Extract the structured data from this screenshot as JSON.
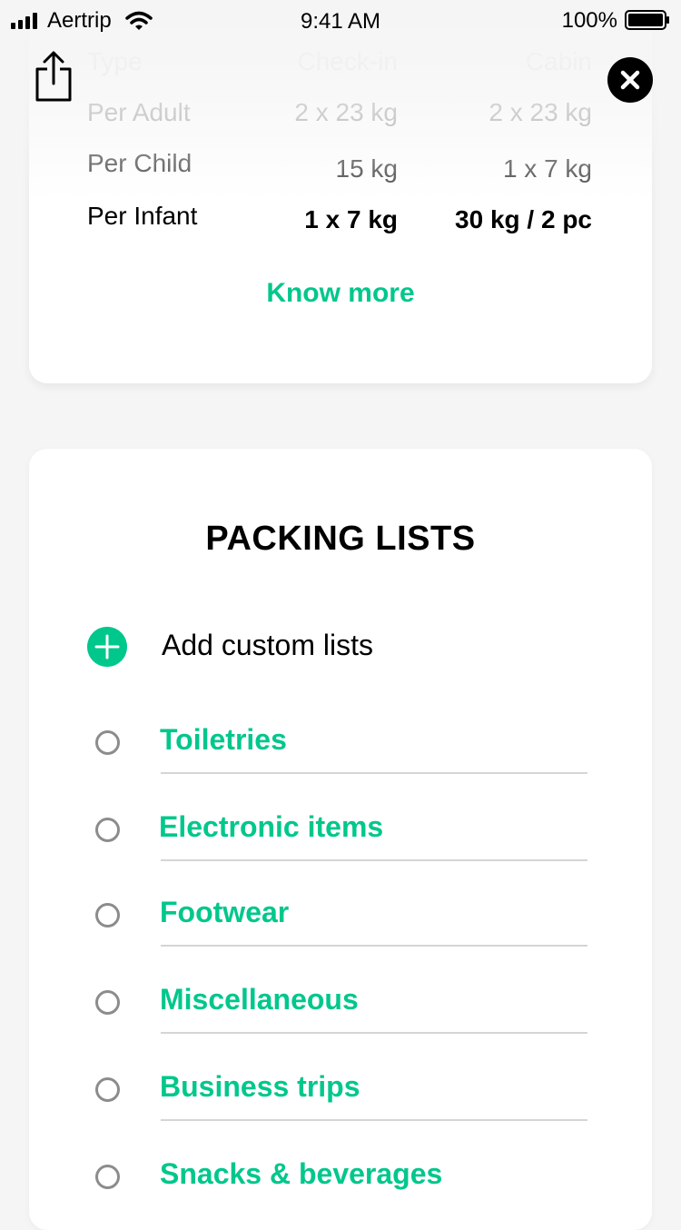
{
  "status_bar": {
    "carrier": "Aertrip",
    "time": "9:41 AM",
    "battery": "100%"
  },
  "baggage": {
    "columns": [
      "Type",
      "Check-in",
      "Cabin"
    ],
    "rows": [
      {
        "type": "Per Adult",
        "checkin": "2 x 23 kg",
        "cabin": "2 x 23 kg"
      },
      {
        "type": "Per Child",
        "checkin": "15 kg",
        "cabin": "1 x 7 kg"
      },
      {
        "type": "Per Infant",
        "checkin": "1 x 7 kg",
        "cabin": "30 kg / 2 pc"
      }
    ],
    "know_more": "Know more"
  },
  "packing": {
    "title": "PACKING LISTS",
    "add_label": "Add custom lists",
    "items": [
      {
        "label": "Toiletries"
      },
      {
        "label": "Electronic items"
      },
      {
        "label": "Footwear"
      },
      {
        "label": "Miscellaneous"
      },
      {
        "label": "Business trips"
      },
      {
        "label": "Snacks & beverages"
      }
    ]
  },
  "colors": {
    "accent": "#00c78c",
    "background": "#f5f5f5",
    "card": "#ffffff",
    "radio": "#8c8c8c"
  },
  "icons": [
    "signal-icon",
    "wifi-icon",
    "battery-icon",
    "share-icon",
    "close-icon",
    "add-icon",
    "radio-icon"
  ]
}
